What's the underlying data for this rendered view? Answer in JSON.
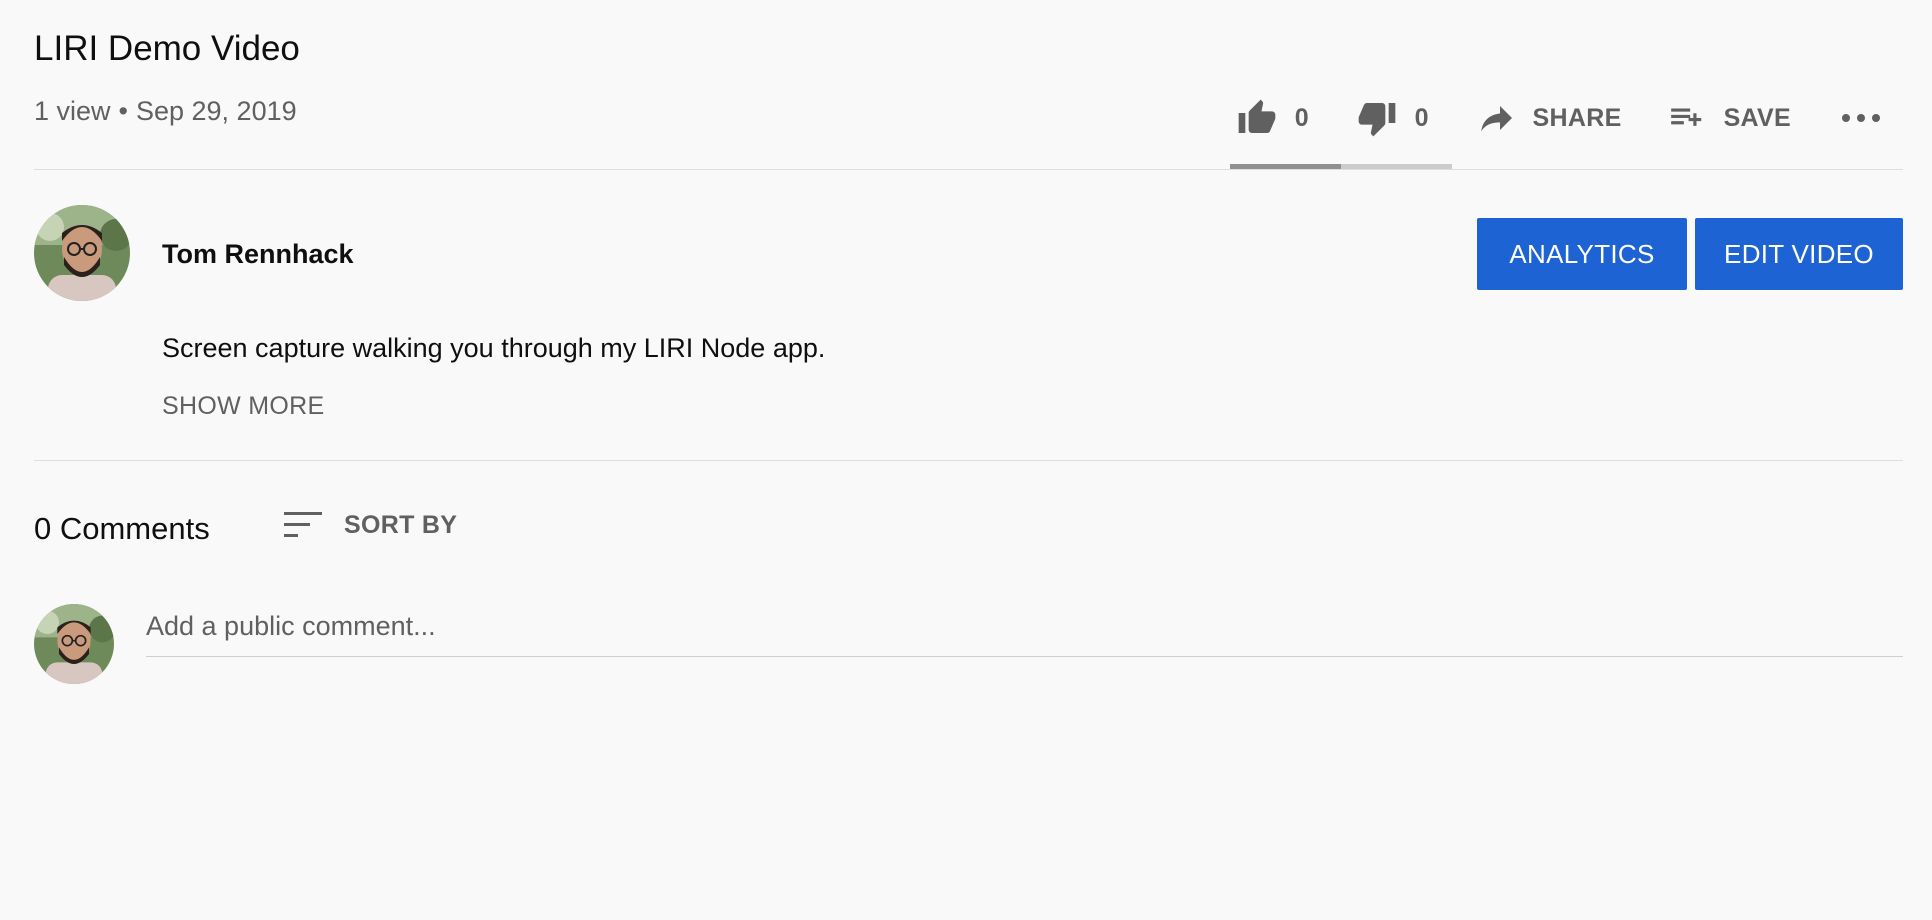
{
  "video": {
    "title": "LIRI Demo Video",
    "views": "1 view",
    "separator": "•",
    "date": "Sep 29, 2019"
  },
  "actions": {
    "like_count": "0",
    "dislike_count": "0",
    "share_label": "SHARE",
    "save_label": "SAVE",
    "like_ratio": 0.5
  },
  "icons": {
    "like": "thumb-up-icon",
    "dislike": "thumb-down-icon",
    "share": "share-arrow-icon",
    "save": "playlist-add-icon",
    "more": "more-horizontal-icon",
    "sort": "sort-icon"
  },
  "channel": {
    "name": "Tom Rennhack",
    "analytics_label": "ANALYTICS",
    "edit_label": "EDIT VIDEO"
  },
  "description": {
    "text": "Screen capture walking you through my LIRI Node app.",
    "show_more_label": "SHOW MORE"
  },
  "comments": {
    "count_label": "0 Comments",
    "sort_label": "SORT BY",
    "input_placeholder": "Add a public comment...",
    "input_value": ""
  },
  "colors": {
    "background": "#f9f9f9",
    "primary_button": "#1e63d3",
    "secondary_text": "#606060",
    "primary_text": "#0f0f0f"
  }
}
